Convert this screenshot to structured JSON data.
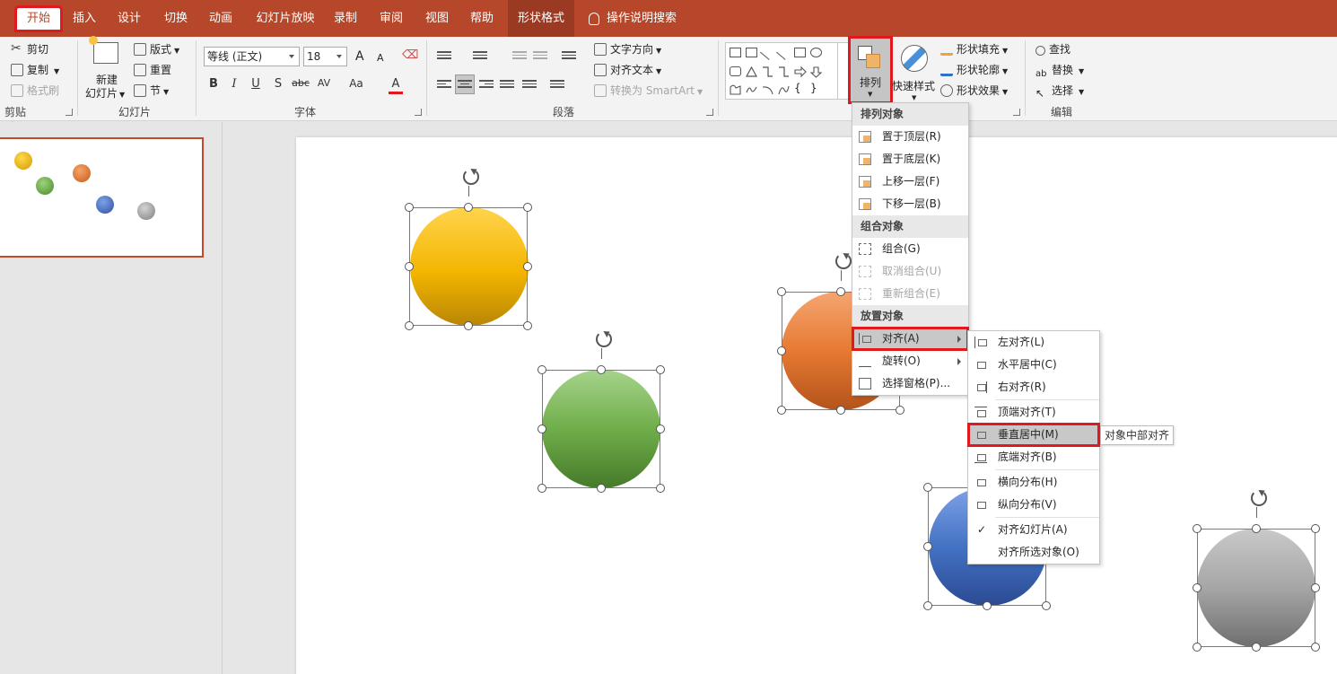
{
  "tabs": {
    "home": "开始",
    "insert": "插入",
    "design": "设计",
    "transitions": "切换",
    "animations": "动画",
    "slideshow": "幻灯片放映",
    "record": "录制",
    "review": "审阅",
    "view": "视图",
    "help": "帮助",
    "shape_format": "形状格式",
    "tell_me": "操作说明搜索"
  },
  "clipboard": {
    "cut": "剪切",
    "copy": "复制",
    "format_painter": "格式刷",
    "label": "剪贴板"
  },
  "slides": {
    "new_slide_line1": "新建",
    "new_slide_line2": "幻灯片",
    "layout": "版式",
    "reset": "重置",
    "section": "节",
    "label": "幻灯片"
  },
  "font": {
    "name": "等线 (正文)",
    "size": "18",
    "bold": "B",
    "italic": "I",
    "underline": "U",
    "shadow": "S",
    "strike": "abc",
    "spacing": "AV",
    "case": "Aa",
    "color": "A",
    "grow": "A",
    "shrink": "A",
    "label": "字体"
  },
  "paragraph": {
    "text_direction": "文字方向",
    "align_text": "对齐文本",
    "smartart": "转换为 SmartArt",
    "label": "段落"
  },
  "drawing": {
    "arrange": "排列",
    "quick_styles": "快速样式",
    "shape_fill": "形状填充",
    "shape_outline": "形状轮廓",
    "shape_effects": "形状效果"
  },
  "editing": {
    "find": "查找",
    "replace": "替换",
    "select": "选择",
    "label": "编辑"
  },
  "arrange_menu": {
    "order_head": "排列对象",
    "bring_front": "置于顶层(R)",
    "send_back": "置于底层(K)",
    "bring_forward": "上移一层(F)",
    "send_backward": "下移一层(B)",
    "group_head": "组合对象",
    "group": "组合(G)",
    "ungroup": "取消组合(U)",
    "regroup": "重新组合(E)",
    "position_head": "放置对象",
    "align": "对齐(A)",
    "rotate": "旋转(O)",
    "selection_pane": "选择窗格(P)..."
  },
  "align_menu": {
    "left": "左对齐(L)",
    "center": "水平居中(C)",
    "right": "右对齐(R)",
    "top": "顶端对齐(T)",
    "middle": "垂直居中(M)",
    "bottom": "底端对齐(B)",
    "dist_h": "横向分布(H)",
    "dist_v": "纵向分布(V)",
    "to_slide": "对齐幻灯片(A)",
    "to_selected": "对齐所选对象(O)",
    "check": "✓"
  },
  "tooltip": "对象中部对齐",
  "colors": {
    "accent": "#b7472a",
    "highlight": "#e0191f"
  }
}
